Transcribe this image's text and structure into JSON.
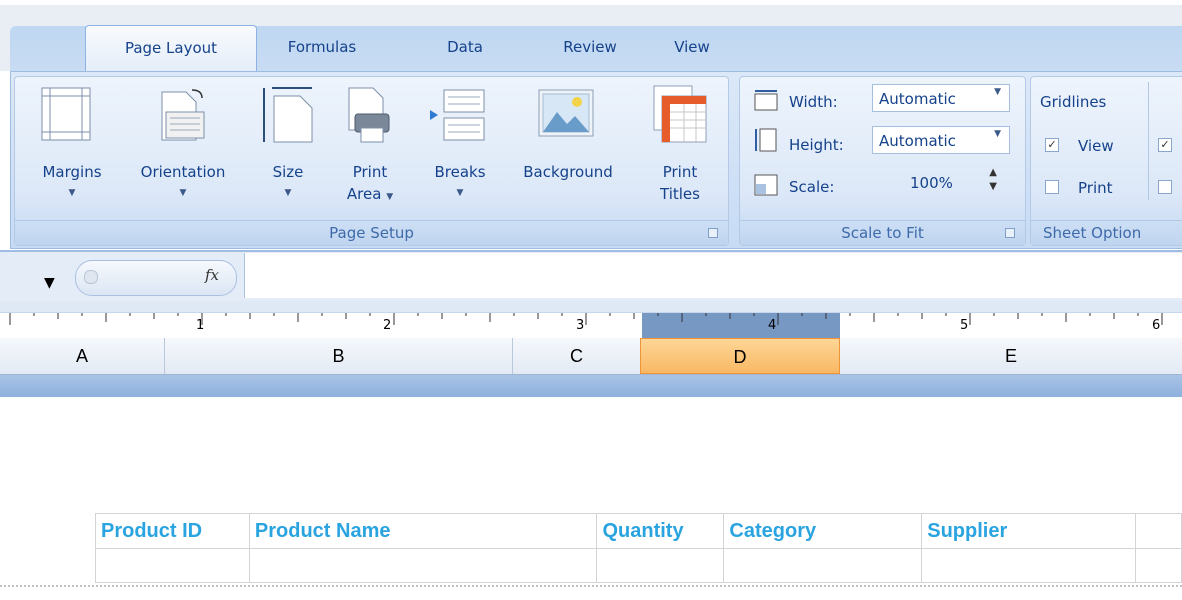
{
  "tabs": [
    "Page Layout",
    "Formulas",
    "Data",
    "Review",
    "View"
  ],
  "page_setup": {
    "margins": "Margins",
    "orientation": "Orientation",
    "size": "Size",
    "print_area_1": "Print",
    "print_area_2": "Area",
    "breaks": "Breaks",
    "background": "Background",
    "print_titles_1": "Print",
    "print_titles_2": "Titles",
    "group_label": "Page Setup"
  },
  "scale_to_fit": {
    "width_label": "Width:",
    "width_value": "Automatic",
    "height_label": "Height:",
    "height_value": "Automatic",
    "scale_label": "Scale:",
    "scale_value": "100%",
    "group_label": "Scale to Fit"
  },
  "sheet_options": {
    "gridlines": "Gridlines",
    "view": "View",
    "print": "Print",
    "view_checked": true,
    "print_checked": false,
    "group_label": "Sheet Option"
  },
  "formula_bar": {
    "fx": "fx",
    "value": ""
  },
  "ruler": [
    "1",
    "2",
    "3",
    "4",
    "5",
    "6"
  ],
  "columns": [
    "A",
    "B",
    "C",
    "D",
    "E"
  ],
  "selected_column": "D",
  "table": {
    "headers": [
      "Product ID",
      "Product Name",
      "Quantity",
      "Category",
      "Supplier"
    ]
  }
}
